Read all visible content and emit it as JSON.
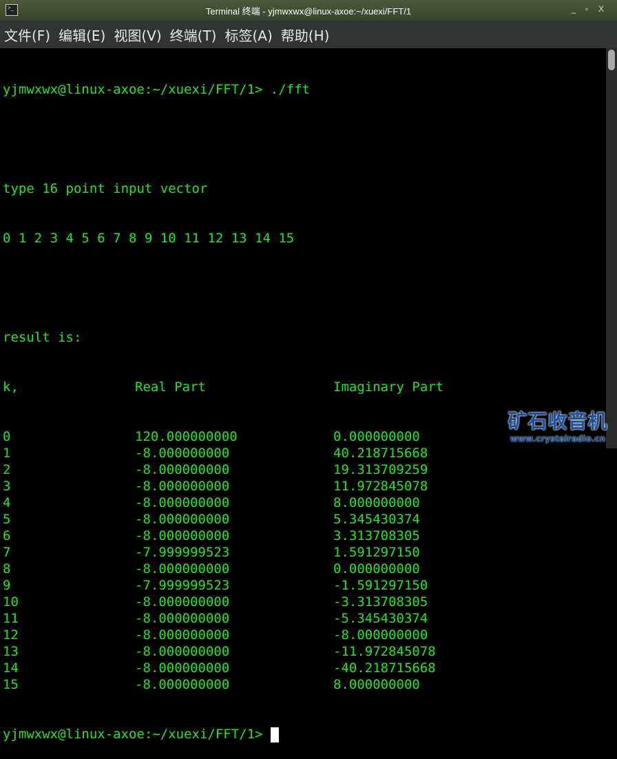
{
  "window": {
    "title": "Terminal 终端 - yjmwxwx@linux-axoe:~/xuexi/FFT/1",
    "minimize": "_",
    "maximize": "▫",
    "close": "X"
  },
  "menu": [
    "文件(F)",
    "编辑(E)",
    "视图(V)",
    "终端(T)",
    "标签(A)",
    "帮助(H)"
  ],
  "terminal": {
    "prompt_cmd": "yjmwxwx@linux-axoe:~/xuexi/FFT/1> ./fft",
    "line_type": "type 16 point input vector",
    "line_input": "0 1 2 3 4 5 6 7 8 9 10 11 12 13 14 15",
    "line_result": "result is:",
    "headers": [
      "k,",
      "Real Part",
      "Imaginary Part"
    ],
    "rows": [
      [
        "0",
        "120.000000000",
        "0.000000000"
      ],
      [
        "1",
        "-8.000000000",
        "40.218715668"
      ],
      [
        "2",
        "-8.000000000",
        "19.313709259"
      ],
      [
        "3",
        "-8.000000000",
        "11.972845078"
      ],
      [
        "4",
        "-8.000000000",
        "8.000000000"
      ],
      [
        "5",
        "-8.000000000",
        "5.345430374"
      ],
      [
        "6",
        "-8.000000000",
        "3.313708305"
      ],
      [
        "7",
        "-7.999999523",
        "1.591297150"
      ],
      [
        "8",
        "-8.000000000",
        "0.000000000"
      ],
      [
        "9",
        "-7.999999523",
        "-1.591297150"
      ],
      [
        "10",
        "-8.000000000",
        "-3.313708305"
      ],
      [
        "11",
        "-8.000000000",
        "-5.345430374"
      ],
      [
        "12",
        "-8.000000000",
        "-8.000000000"
      ],
      [
        "13",
        "-8.000000000",
        "-11.972845078"
      ],
      [
        "14",
        "-8.000000000",
        "-40.218715668"
      ],
      [
        "15",
        "-8.000000000",
        "8.000000000"
      ]
    ],
    "prompt_end": "yjmwxwx@linux-axoe:~/xuexi/FFT/1> "
  },
  "watermark": {
    "title": "矿石收音机",
    "url": "www.crystalradio.cn"
  }
}
